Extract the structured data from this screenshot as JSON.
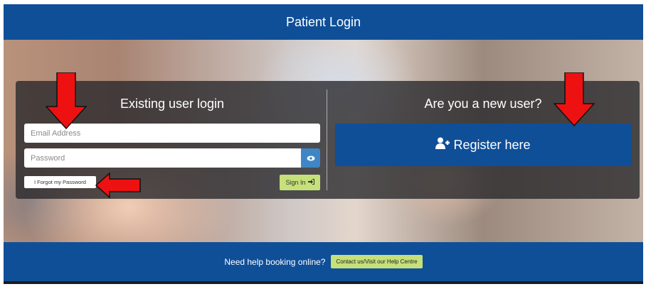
{
  "header": {
    "title": "Patient Login"
  },
  "login": {
    "title": "Existing user login",
    "email_placeholder": "Email Address",
    "password_placeholder": "Password",
    "forgot_label": "I Forgot my Password",
    "signin_label": "Sign In"
  },
  "register": {
    "title": "Are you a new user?",
    "button_label": "Register here"
  },
  "footer": {
    "help_text": "Need help booking online?",
    "contact_label": "Contact us/Visit our Help Centre"
  },
  "icons": [
    "eye-icon",
    "sign-in-icon",
    "user-plus-icon",
    "arrow-down-icon",
    "arrow-left-icon"
  ],
  "colors": {
    "header_blue": "#0f4f98",
    "accent_green": "#c6e07a",
    "eye_button_blue": "#3f86c6",
    "arrow_red": "#ee1111"
  }
}
